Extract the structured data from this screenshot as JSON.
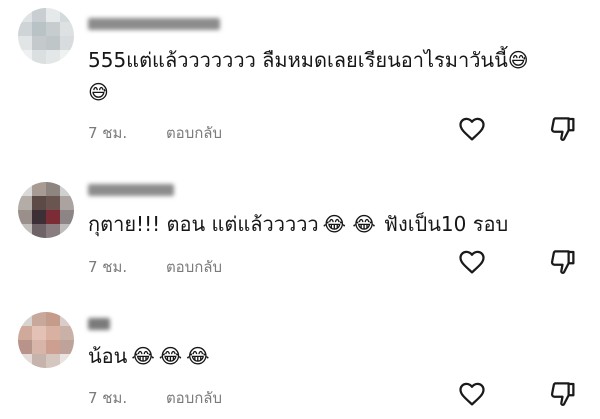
{
  "comments": [
    {
      "text_line1": "555แต่แล้ววววววว ลืมหมดเลยเรียนอาไรมาวันนี้",
      "emoji_inline": "😅",
      "text_line2_emoji": "😅",
      "time": "7 ชม.",
      "reply_label": "ตอบกลับ"
    },
    {
      "text_prefix": "กุตาย!!! ตอน แต่แล้ววววว",
      "emojis": "😂 😂",
      "text_suffix": "ฟังเป็น10 รอบ",
      "time": "7 ชม.",
      "reply_label": "ตอบกลับ"
    },
    {
      "username": "ดิ",
      "text": "น้อน",
      "emojis": "😂😂😂",
      "time": "7 ชม.",
      "reply_label": "ตอบกลับ"
    }
  ],
  "icons": {
    "like": "heart-icon",
    "dislike": "thumbs-down-icon"
  },
  "colors": {
    "text": "#161616",
    "meta": "#7b7b7b",
    "icon": "#1a1a1a"
  }
}
